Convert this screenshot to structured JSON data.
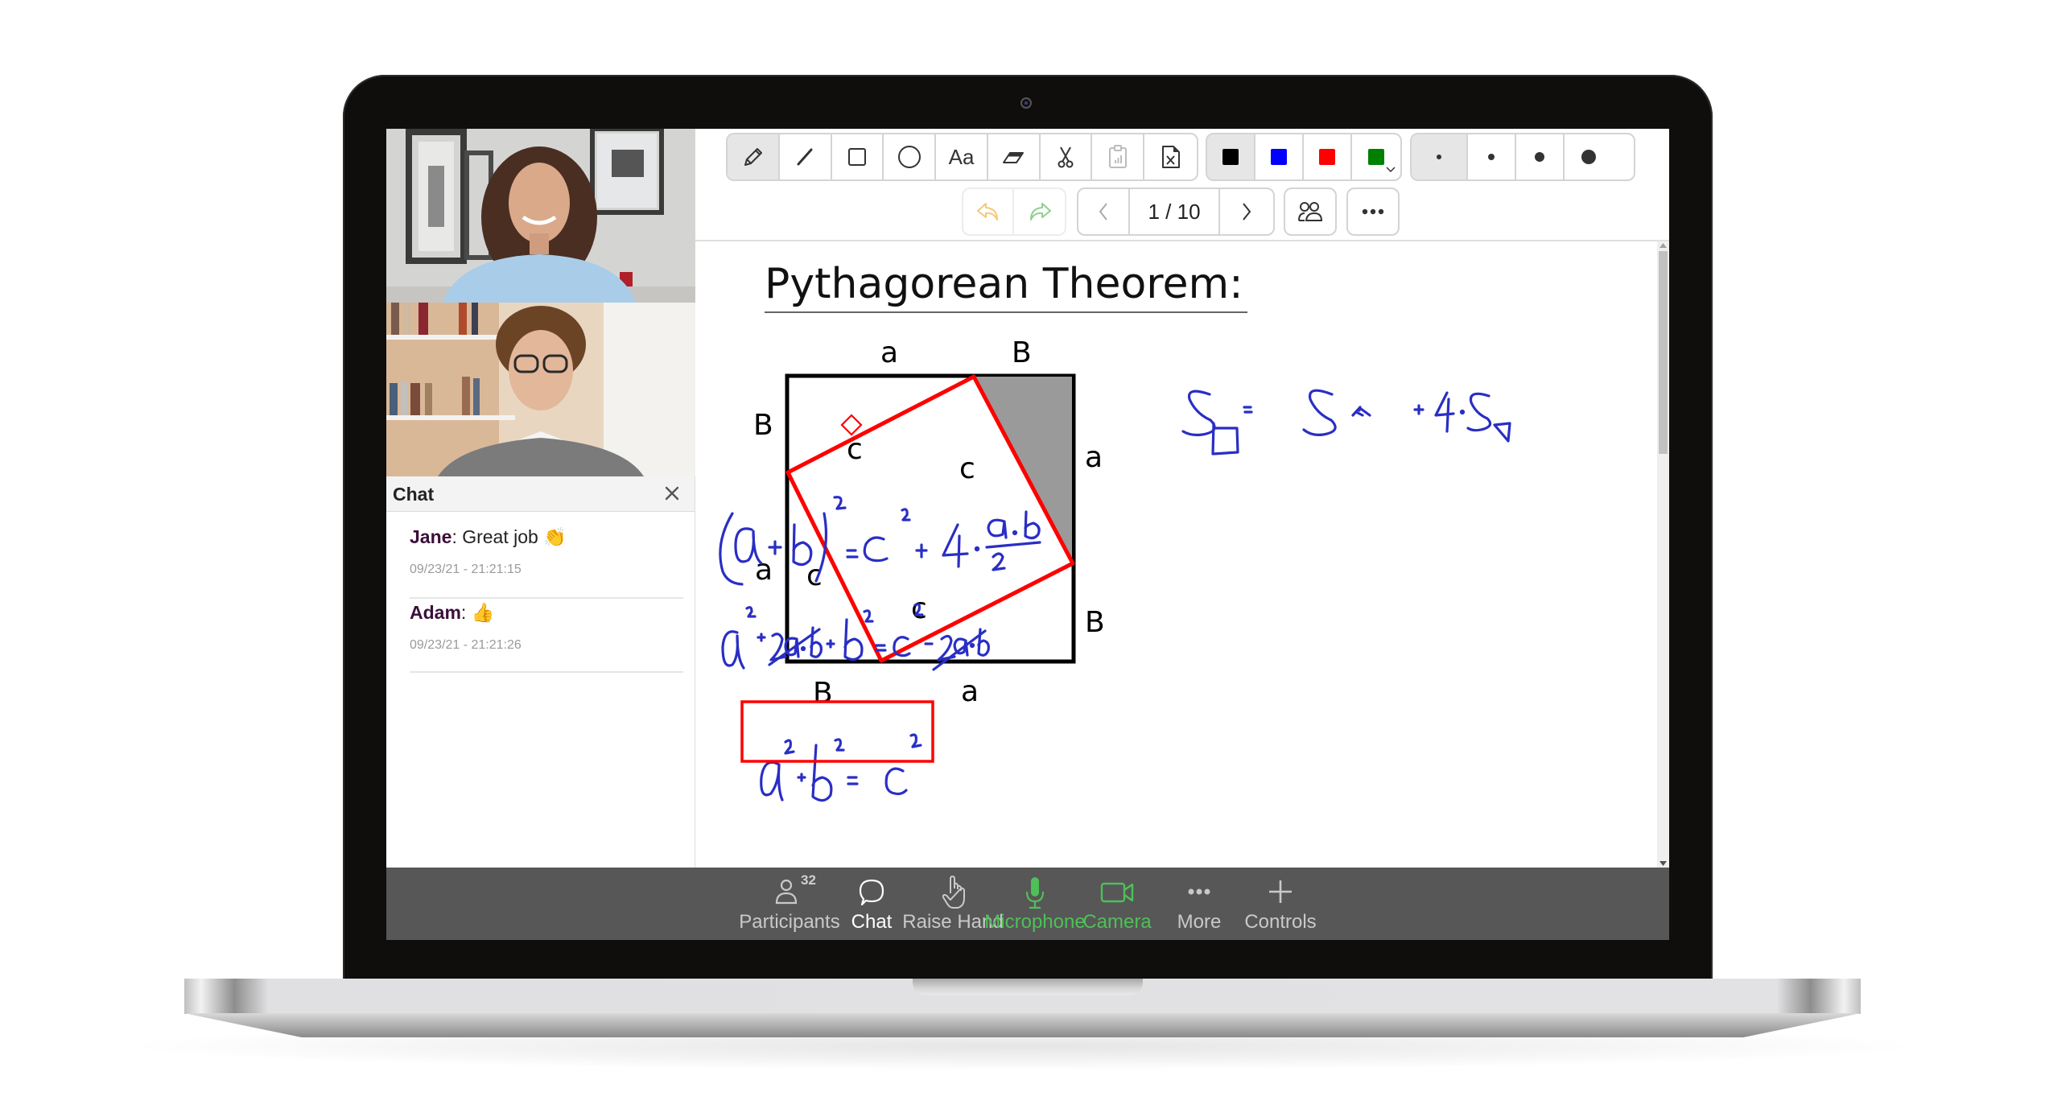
{
  "app": {
    "participants": [
      {
        "name": "video-participant-1",
        "label": "Woman with curly hair in light blue sweater"
      },
      {
        "name": "video-participant-2",
        "label": "Man with glasses in grey sweater"
      }
    ]
  },
  "chat": {
    "title": "Chat",
    "messages": [
      {
        "author": "Jane",
        "text": ": Great job ",
        "emoji": "👏",
        "time": "09/23/21 - 21:21:15"
      },
      {
        "author": "Adam",
        "text": ": ",
        "emoji": "👍",
        "time": "09/23/21 - 21:21:26"
      }
    ],
    "input": {
      "value": "",
      "placeholder": ""
    }
  },
  "toolbar": {
    "tools": [
      {
        "id": "pencil",
        "icon": "pencil-icon",
        "active": true
      },
      {
        "id": "line",
        "icon": "line-icon",
        "active": false
      },
      {
        "id": "rectangle",
        "icon": "rectangle-icon",
        "active": false
      },
      {
        "id": "ellipse",
        "icon": "ellipse-icon",
        "active": false
      },
      {
        "id": "text",
        "icon": "text-icon",
        "label": "Aa",
        "active": false
      },
      {
        "id": "eraser",
        "icon": "eraser-icon",
        "active": false
      },
      {
        "id": "cut",
        "icon": "scissors-icon",
        "active": false
      },
      {
        "id": "paste",
        "icon": "clipboard-icon",
        "active": false,
        "disabled": true
      },
      {
        "id": "clear",
        "icon": "delete-file-icon",
        "active": false
      }
    ],
    "colors": [
      {
        "name": "black",
        "hex": "#000000",
        "active": true
      },
      {
        "name": "blue",
        "hex": "#0000ff",
        "active": false
      },
      {
        "name": "red",
        "hex": "#ff0000",
        "active": false
      },
      {
        "name": "green",
        "hex": "#008000",
        "active": false,
        "has_dropdown": true
      }
    ],
    "sizes": [
      {
        "name": "size-1",
        "active": true
      },
      {
        "name": "size-2",
        "active": false
      },
      {
        "name": "size-3",
        "active": false
      },
      {
        "name": "size-4",
        "active": false
      }
    ],
    "undo_color": "#f5c97a",
    "redo_color": "#8fcf8f",
    "page": {
      "current": 1,
      "total": 10,
      "label": "1 / 10"
    }
  },
  "whiteboard": {
    "title": "Pythagorean Theorem:",
    "diagram_labels": {
      "top": [
        "a",
        "B"
      ],
      "left": [
        "B",
        "a"
      ],
      "right": [
        "a",
        "B"
      ],
      "bottom": [
        "B",
        "a"
      ],
      "inner": [
        "c",
        "c",
        "c",
        "c"
      ]
    },
    "equations": [
      "S□ = S◇ + 4·S◁",
      "(a+b)² = c² + 4·(a·b)/2",
      "a² + 2a·b + b² = c² + 2a·b",
      "a² + b² = c²"
    ],
    "ink_color": "#2a2ec4",
    "highlight_color": "#ff0000"
  },
  "bottombar": {
    "participants_count": "32",
    "items": [
      {
        "id": "participants",
        "label": "Participants",
        "icon": "person-icon",
        "state": "normal"
      },
      {
        "id": "chat",
        "label": "Chat",
        "icon": "chat-bubble-icon",
        "state": "active"
      },
      {
        "id": "raise-hand",
        "label": "Raise Hand",
        "icon": "hand-icon",
        "state": "normal"
      },
      {
        "id": "microphone",
        "label": "Microphone",
        "icon": "microphone-icon",
        "state": "on"
      },
      {
        "id": "camera",
        "label": "Camera",
        "icon": "camera-icon",
        "state": "on"
      },
      {
        "id": "more",
        "label": "More",
        "icon": "more-icon",
        "state": "normal"
      },
      {
        "id": "controls",
        "label": "Controls",
        "icon": "plus-icon",
        "state": "normal"
      }
    ],
    "active_color": "#ffffff",
    "on_color": "#4fbf58",
    "normal_color": "#c9c9c9"
  }
}
